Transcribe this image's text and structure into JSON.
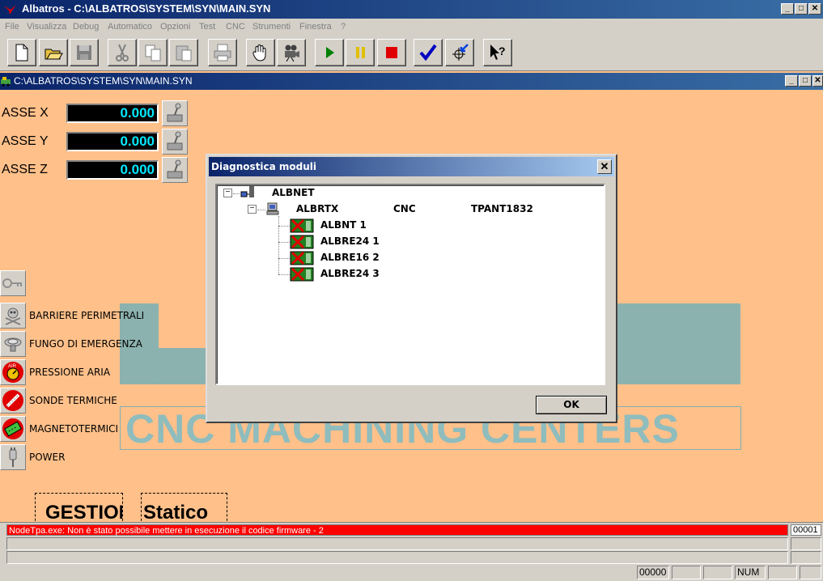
{
  "window": {
    "title": "Albatros - C:\\ALBATROS\\SYSTEM\\SYN\\MAIN.SYN",
    "controls": [
      "_",
      "□",
      "✕"
    ]
  },
  "menu": [
    "File",
    "Visualizza",
    "Debug",
    "Automatico",
    "Opzioni",
    "Test",
    "CNC",
    "Strumenti",
    "Finestra",
    "?"
  ],
  "toolbar": {
    "buttons": [
      "new-file-icon",
      "open-folder-icon",
      "save-disk-icon",
      "cut-icon",
      "copy-icon",
      "paste-icon",
      "print-icon",
      "hand-icon",
      "camera-icon",
      "play-icon",
      "pause-icon",
      "stop-icon",
      "check-icon",
      "target-icon",
      "help-cursor-icon"
    ],
    "colors": {
      "play": "#008000",
      "pause": "#e0c000",
      "stop": "#e00000",
      "check": "#0000c0"
    }
  },
  "child": {
    "title": "C:\\ALBATROS\\SYSTEM\\SYN\\MAIN.SYN"
  },
  "axes": [
    {
      "label": "ASSE X",
      "value": "0.000"
    },
    {
      "label": "ASSE Y",
      "value": "0.000"
    },
    {
      "label": "ASSE Z",
      "value": "0.000"
    }
  ],
  "logo": {
    "tagline": "CNC MACHINING CENTERS"
  },
  "status_items": [
    {
      "label": "BARRIERE PERIMETRALI",
      "icon": "skull-icon"
    },
    {
      "label": "FUNGO DI EMERGENZA",
      "icon": "emergency-button-icon"
    },
    {
      "label": "PRESSIONE ARIA",
      "icon": "air-gauge-icon"
    },
    {
      "label": "SONDE TERMICHE",
      "icon": "thermometer-icon"
    },
    {
      "label": "MAGNETOTERMICI",
      "icon": "breaker-icon"
    },
    {
      "label": "POWER",
      "icon": "power-plug-icon"
    }
  ],
  "boxes": {
    "gestione": "GESTIONE",
    "statico": "Statico"
  },
  "messages": {
    "error": "NodeTpa.exe: Non è stato possibile mettere in esecuzione il codice firmware - 2",
    "count": "00001"
  },
  "statusbar": {
    "counter": "00000",
    "num": "NUM"
  },
  "dialog": {
    "title": "Diagnostica moduli",
    "close": "✕",
    "ok": "OK",
    "tree": {
      "root": "ALBNET",
      "node": {
        "name": "ALBRTX",
        "type": "CNC",
        "host": "TPANT1832"
      },
      "children": [
        "ALBNT 1",
        "ALBRE24 1",
        "ALBRE16 2",
        "ALBRE24 3"
      ]
    }
  }
}
